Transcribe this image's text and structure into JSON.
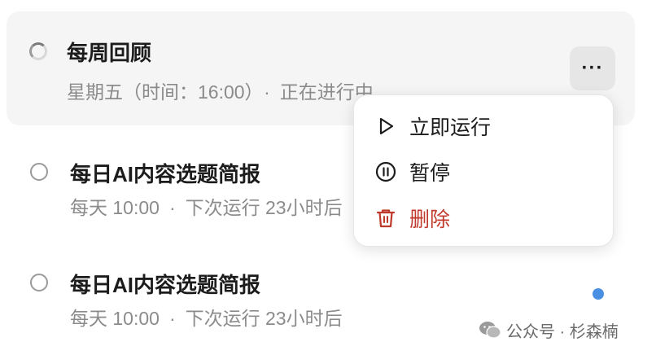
{
  "tasks": [
    {
      "title": "每周回顾",
      "schedule": "星期五（时间：16:00）",
      "separator": "·",
      "status": "正在进行中",
      "icon": "spinner-icon"
    },
    {
      "title": "每日AI内容选题简报",
      "schedule": "每天 10:00",
      "separator": "·",
      "status": "下次运行 23小时后",
      "icon": "circle-icon"
    },
    {
      "title": "每日AI内容选题简报",
      "schedule": "每天 10:00",
      "separator": "·",
      "status": "下次运行 23小时后",
      "icon": "circle-icon"
    }
  ],
  "more_button": {
    "label": "···"
  },
  "context_menu": {
    "items": [
      {
        "label": "立即运行",
        "icon": "play-icon"
      },
      {
        "label": "暂停",
        "icon": "pause-icon"
      },
      {
        "label": "删除",
        "icon": "trash-icon"
      }
    ]
  },
  "watermark": {
    "text": "公众号 · 杉森楠"
  },
  "colors": {
    "active_row_bg": "#f5f5f5",
    "danger": "#c0392b",
    "unread_dot": "#4a90e2",
    "muted_text": "#8b8b8b"
  }
}
